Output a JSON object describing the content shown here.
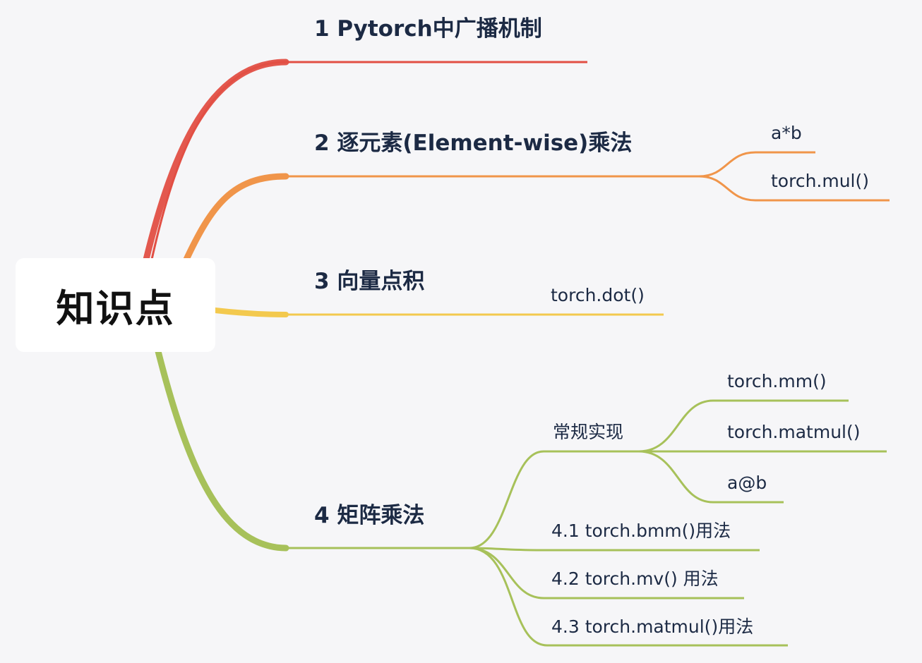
{
  "root": {
    "label": "知识点"
  },
  "branches": [
    {
      "id": "b1",
      "label": "1 Pytorch中广播机制",
      "color": "#e24f44",
      "children": []
    },
    {
      "id": "b2",
      "label": "2 逐元素(Element-wise)乘法",
      "color": "#f0954a",
      "children": [
        {
          "label": "a*b"
        },
        {
          "label": "torch.mul()"
        }
      ]
    },
    {
      "id": "b3",
      "label": "3 向量点积",
      "color": "#f3c94e",
      "children": [
        {
          "label": "torch.dot()"
        }
      ]
    },
    {
      "id": "b4",
      "label": "4 矩阵乘法",
      "color": "#a7c15a",
      "children": [
        {
          "label": "常规实现",
          "children": [
            {
              "label": "torch.mm()"
            },
            {
              "label": "torch.matmul()"
            },
            {
              "label": "a@b"
            }
          ]
        },
        {
          "label": "4.1  torch.bmm()用法"
        },
        {
          "label": "4.2  torch.mv() 用法"
        },
        {
          "label": "4.3  torch.matmul()用法"
        }
      ]
    }
  ]
}
